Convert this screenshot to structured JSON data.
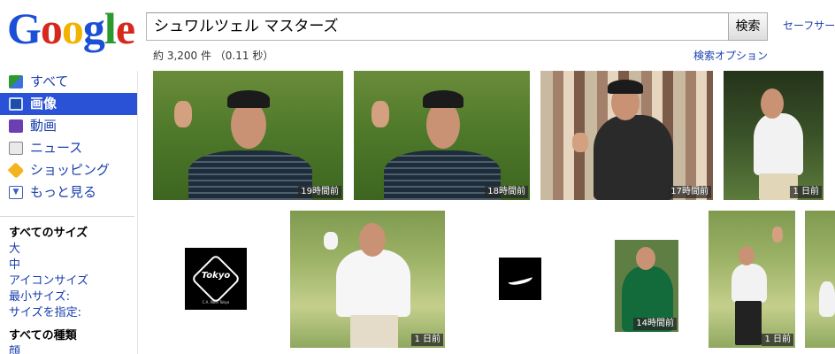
{
  "logo": {
    "letters": [
      "G",
      "o",
      "o",
      "g",
      "l",
      "e"
    ]
  },
  "search": {
    "query": "シュワルツェル マスターズ",
    "button_label": "検索"
  },
  "header": {
    "safe_search": "セーフサーチ",
    "result_stats": "約 3,200 件 （0.11 秒）",
    "advanced_search": "検索オプション"
  },
  "sidebar": {
    "items": [
      {
        "label": "すべて",
        "icon": "all-icon"
      },
      {
        "label": "画像",
        "icon": "image-icon",
        "active": true
      },
      {
        "label": "動画",
        "icon": "video-icon"
      },
      {
        "label": "ニュース",
        "icon": "news-icon"
      },
      {
        "label": "ショッピング",
        "icon": "shopping-tag-icon"
      },
      {
        "label": "もっと見る",
        "icon": "chevron-down-icon"
      }
    ],
    "size_heading": "すべてのサイズ",
    "sizes": [
      "大",
      "中",
      "アイコンサイズ",
      "最小サイズ:",
      "サイズを指定:"
    ],
    "type_heading": "すべての種類",
    "types": [
      "顔"
    ]
  },
  "images": {
    "row1": [
      {
        "time": "19時間前"
      },
      {
        "time": "18時間前"
      },
      {
        "time": "17時間前"
      },
      {
        "time": "1 日前"
      }
    ],
    "row2": [
      {
        "time": "",
        "logo_text": "Tokyo",
        "logo_sub": "C.A. Noel Tokyo"
      },
      {
        "time": "1 日前"
      },
      {
        "time": ""
      },
      {
        "time": "14時間前"
      },
      {
        "time": "1 日前"
      }
    ]
  }
}
